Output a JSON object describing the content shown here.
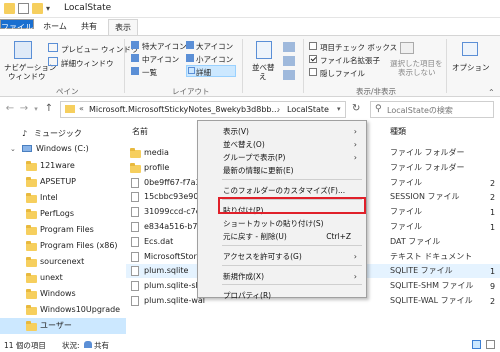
{
  "window": {
    "title": "LocalState"
  },
  "ribbon": {
    "tabs": [
      "ファイル",
      "ホーム",
      "共有",
      "表示"
    ],
    "panes": {
      "nav_pane": "ナビゲーション",
      "nav_pane2": "ウィンドウ",
      "preview": "プレビュー ウィンドウ",
      "details": "詳細ウィンドウ",
      "group": "ペイン"
    },
    "layout": {
      "xl": "特大アイコン",
      "l": "大アイコン",
      "m": "中アイコン",
      "s": "小アイコン",
      "list": "一覧",
      "details": "詳細",
      "group": "レイアウト"
    },
    "sort": {
      "label1": "並べ替",
      "label2": "え"
    },
    "show": {
      "item_checkbox": "項目チェック ボックス",
      "file_ext": "ファイル名拡張子",
      "hidden": "隠しファイル",
      "hide_selected1": "選択した項目を",
      "hide_selected2": "表示しない",
      "group": "表示/非表示"
    },
    "options": "オプション"
  },
  "address": {
    "path1": "Microsoft.MicrosoftStickyNotes_8wekyb3d8bb...",
    "sep": "›",
    "path2": "LocalState",
    "search_placeholder": "LocalStateの検索",
    "prefix": "«"
  },
  "nav": {
    "items": [
      {
        "label": "ミュージック"
      },
      {
        "label": "Windows (C:)"
      },
      {
        "label": "121ware"
      },
      {
        "label": "APSETUP"
      },
      {
        "label": "Intel"
      },
      {
        "label": "PerfLogs"
      },
      {
        "label": "Program Files"
      },
      {
        "label": "Program Files (x86)"
      },
      {
        "label": "sourcenext"
      },
      {
        "label": "unext"
      },
      {
        "label": "Windows"
      },
      {
        "label": "Windows10Upgrade"
      },
      {
        "label": "ユーザー"
      }
    ]
  },
  "list": {
    "col_name": "名前",
    "col_type": "種類",
    "rows": [
      {
        "name": "media",
        "type": "ファイル フォルダー"
      },
      {
        "name": "profile",
        "type": "ファイル フォルダー"
      },
      {
        "name": "0be9ff67-f7a3-4",
        "type": "ファイル"
      },
      {
        "name": "15cbbc93e90a4d",
        "type": "SESSION ファイル"
      },
      {
        "name": "31099ccd-c7e0-",
        "type": "ファイル"
      },
      {
        "name": "e834a516-b712-",
        "type": "ファイル"
      },
      {
        "name": "Ecs.dat",
        "type": "DAT ファイル"
      },
      {
        "name": "MicrosoftStoreE",
        "type": "テキスト ドキュメント"
      },
      {
        "name": "plum.sqlite",
        "type": "SQLITE ファイル"
      },
      {
        "name": "plum.sqlite-shm",
        "type": "SQLITE-SHM ファイル"
      },
      {
        "name": "plum.sqlite-wal",
        "type": "SQLITE-WAL ファイル"
      }
    ],
    "trunc": [
      "2",
      "2",
      "1",
      "1",
      "1",
      "9",
      "2"
    ]
  },
  "status": {
    "count": "11 個の項目",
    "state_label": "状況:",
    "state": "共有"
  },
  "menu": {
    "items": [
      {
        "label": "表示(V)",
        "arrow": "›"
      },
      {
        "label": "並べ替え(O)",
        "arrow": "›"
      },
      {
        "label": "グループで表示(P)",
        "arrow": "›"
      },
      {
        "label": "最新の情報に更新(E)"
      },
      {
        "label": "このフォルダーのカスタマイズ(F)..."
      },
      {
        "label": "貼り付け(P)"
      },
      {
        "label": "ショートカットの貼り付け(S)"
      },
      {
        "label": "元に戻す - 削除(U)",
        "shortcut": "Ctrl+Z"
      },
      {
        "label": "アクセスを許可する(G)",
        "arrow": "›"
      },
      {
        "label": "新規作成(X)",
        "arrow": "›"
      },
      {
        "label": "プロパティ(R)"
      }
    ]
  },
  "colors": {
    "accent": "#1a6fd0",
    "highlight_box": "#e0202a",
    "folder": "#f6cf5e"
  }
}
